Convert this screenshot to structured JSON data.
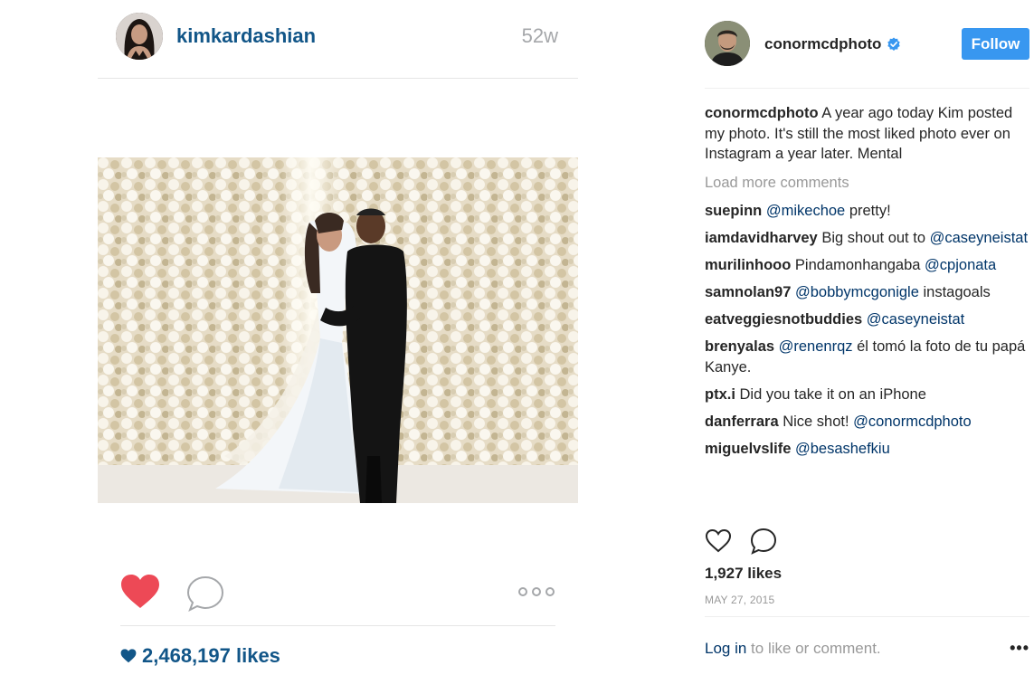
{
  "embed": {
    "username": "kimkardashian",
    "time": "52w",
    "likes": "2,468,197 likes",
    "icons": {
      "like": "heart-filled-icon",
      "comment": "comment-bubble-icon",
      "more": "more-dots-icon",
      "likes_heart": "small-heart-icon"
    },
    "colors": {
      "username": "#125688",
      "heart": "#ed4956"
    }
  },
  "panel": {
    "username": "conormcdphoto",
    "follow_label": "Follow",
    "caption": {
      "user": "conormcdphoto",
      "text": "A year ago today Kim posted my photo. It's still the most liked photo ever on Instagram a year later. Mental"
    },
    "load_more": "Load more comments",
    "comments": [
      {
        "user": "suepinn",
        "mention": "@mikechoe",
        "text": " pretty!"
      },
      {
        "user": "iamdavidharvey",
        "text": "Big shout out to ",
        "mention": "@caseyneistat"
      },
      {
        "user": "murilinhooo",
        "text": "Pindamonhangaba ",
        "mention": "@cpjonata"
      },
      {
        "user": "samnolan97",
        "mention": "@bobbymcgonigle",
        "text": " instagoals"
      },
      {
        "user": "eatveggiesnotbuddies",
        "mention": "@caseyneistat"
      },
      {
        "user": "brenyalas",
        "mention": "@renenrqz",
        "text": " él tomó la foto de tu papá Kanye."
      },
      {
        "user": "ptx.i",
        "text": "Did you take it on an iPhone"
      },
      {
        "user": "danferrara",
        "text": "Nice shot! ",
        "mention": "@conormcdphoto"
      },
      {
        "user": "miguelvslife",
        "mention": "@besashefkiu"
      }
    ],
    "likes": "1,927 likes",
    "date": "MAY 27, 2015",
    "login_link": "Log in",
    "login_text": " to like or comment.",
    "more": "•••",
    "colors": {
      "follow_bg": "#3897f0",
      "mention": "#003569",
      "muted": "#999999"
    },
    "icons": {
      "verified": "verified-badge-icon",
      "like": "heart-outline-icon",
      "comment": "comment-outline-icon"
    }
  }
}
